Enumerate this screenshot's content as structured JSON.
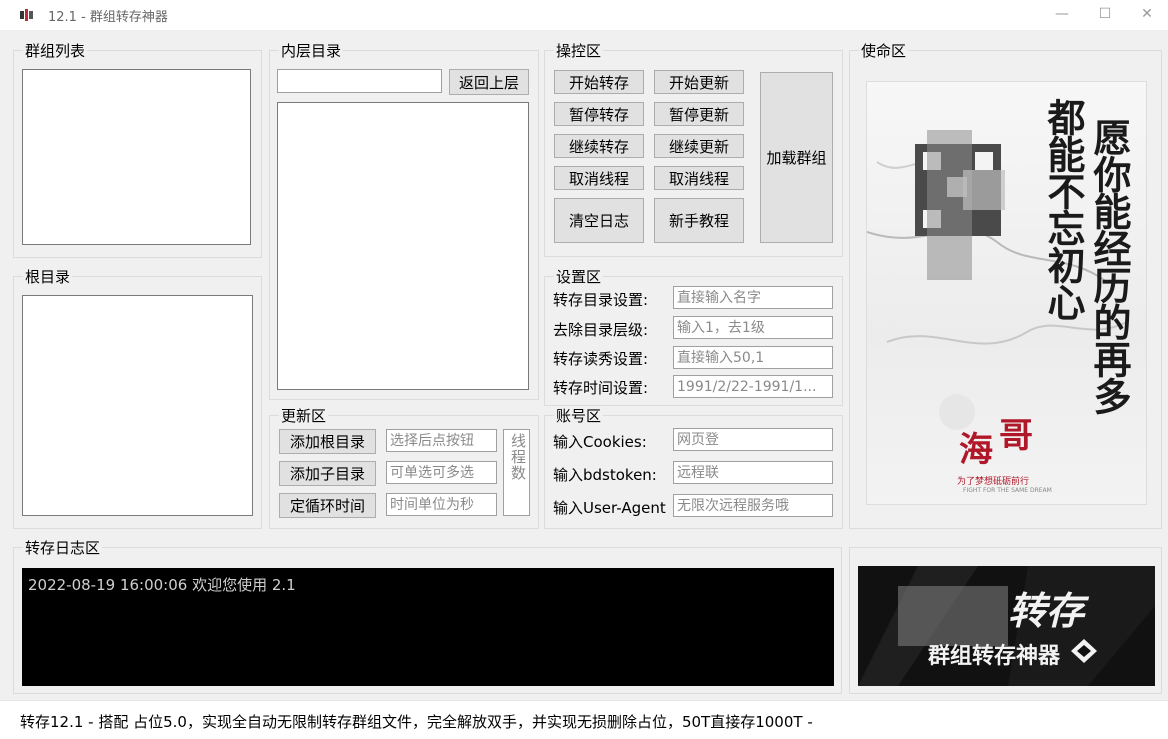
{
  "window": {
    "title": "12.1 - 群组转存神器",
    "minimize": "—",
    "maximize": "☐",
    "close": "✕"
  },
  "groups": {
    "group_list": "群组列表",
    "root_dir": "根目录",
    "inner_dir": "内层目录",
    "control": "操控区",
    "mission": "使命区",
    "settings": "设置区",
    "update": "更新区",
    "account": "账号区",
    "log": "转存日志区"
  },
  "inner_dir": {
    "back_button": "返回上层",
    "path_value": ""
  },
  "control": {
    "start_transfer": "开始转存",
    "start_update": "开始更新",
    "pause_transfer": "暂停转存",
    "pause_update": "暂停更新",
    "resume_transfer": "继续转存",
    "resume_update": "继续更新",
    "cancel_thread_1": "取消线程",
    "cancel_thread_2": "取消线程",
    "clear_log": "清空日志",
    "tutorial": "新手教程",
    "load_group": "加载群组"
  },
  "settings": {
    "dir_label": "转存目录设置:",
    "dir_placeholder": "直接输入名字",
    "strip_label": "去除目录层级:",
    "strip_placeholder": "输入1，去1级",
    "speed_label": "转存读秀设置:",
    "speed_placeholder": "直接输入50,1",
    "time_label": "转存时间设置:",
    "time_placeholder": "1991/2/22-1991/1..."
  },
  "update": {
    "add_root": "添加根目录",
    "add_root_hint": "选择后点按钮",
    "add_sub": "添加子目录",
    "add_sub_hint": "可单选可多选",
    "set_loop": "定循环时间",
    "set_loop_hint": "时间单位为秒",
    "threads_label": "线程数"
  },
  "account": {
    "cookies_label": "输入Cookies:",
    "cookies_value": "网页登",
    "bdstoken_label": "输入bdstoken:",
    "bdstoken_value": "远程联",
    "ua_label": "输入User-Agent",
    "ua_value": "无限次远程服务哦"
  },
  "log": {
    "line": "2022-08-19 16:00:06 欢迎您使用 2.1"
  },
  "poster": {
    "text_col_right": "愿你能经历的再多",
    "text_col_left": "都能不忘初心",
    "brand_1": "海",
    "brand_2": "哥",
    "slogan": "为了梦想砥砺前行",
    "slogan_en": "FIGHT FOR THE SAME DREAM"
  },
  "banner": {
    "title": "转存",
    "subtitle": "群组转存神器"
  },
  "status": {
    "text": "转存12.1 - 搭配 占位5.0，实现全自动无限制转存群组文件，完全解放双手，并实现无损删除占位，50T直接存1000T -"
  },
  "colors": {
    "window_bg": "#f0f0f0",
    "button_bg": "#e1e1e1",
    "log_bg": "#000000",
    "poster_red": "#b0182a"
  }
}
